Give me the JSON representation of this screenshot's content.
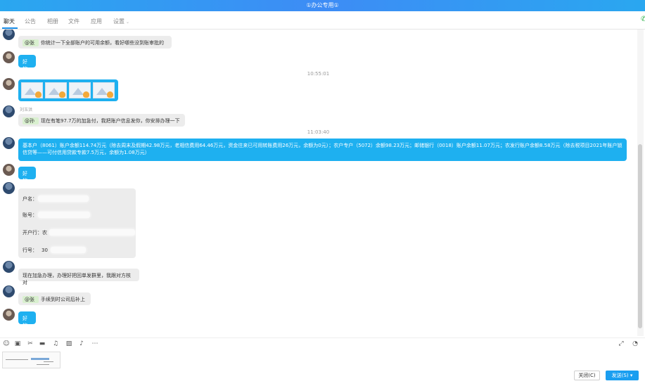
{
  "window": {
    "title": "①办公专用①"
  },
  "tabs": [
    {
      "label": "聊天",
      "active": true
    },
    {
      "label": "公告"
    },
    {
      "label": "相册"
    },
    {
      "label": "文件"
    },
    {
      "label": "应用"
    },
    {
      "label": "设置"
    }
  ],
  "messages": {
    "m1": {
      "mention": "@张",
      "text": "你统计一下全部账户的可用余额，看好哪些没到账审批的"
    },
    "m2": {
      "text": "好的"
    },
    "ts1": "10:55:01",
    "m4": {
      "sender": "刘玉洪",
      "mention": "@孙",
      "text": "现在有笔97.7万的加急付，我把账户信息发你，你安排办理一下"
    },
    "ts2": "11:03:40",
    "m5": {
      "line1": "基本户（8061）账户余额114.74万元（除去周末及假期42.98万元，老相信费用64.46万元，资金往来已可用转账费用26万元，余额为0元）；农户专户（5072）余额98.23万元；邮储银行（0018）账户余额11.07万元；农发行账户余额8.58万元（除去税项目2021年账户锁政",
      "line2": "信贷等——可付信用贷款专款7.5万元，余额为1.08万元）"
    },
    "m6": {
      "text": "好的"
    },
    "card": {
      "name_label": "户名：",
      "account_label": "账号：",
      "bank_label": "开户行：",
      "bank_value": "农",
      "code_label": "行号：",
      "code_value": "30"
    },
    "m8": {
      "text": "现在加急办理，办理好把回单发群里，我跟对方核对"
    },
    "m9": {
      "mention": "@张",
      "text": "手续到时公司后补上"
    },
    "m10": {
      "text": "好的"
    }
  },
  "buttons": {
    "close": "关闭(C)",
    "send": "发送(S)"
  },
  "icons": [
    "emoji-icon",
    "screenshot-icon",
    "scissors-icon",
    "folder-icon",
    "music-icon",
    "image-icon",
    "bell-icon",
    "more-icon",
    "expand-icon",
    "clock-icon"
  ]
}
